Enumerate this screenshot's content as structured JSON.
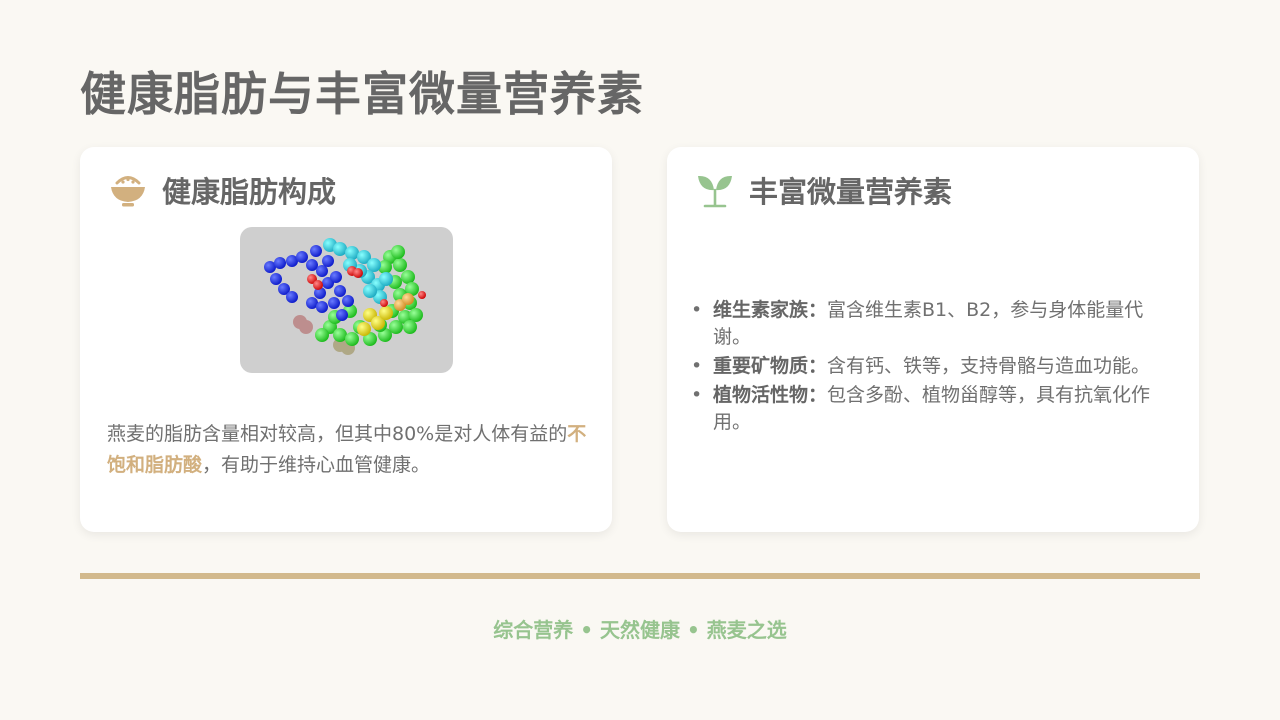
{
  "title": "健康脂肪与丰富微量营养素",
  "left_card": {
    "heading": "健康脂肪构成",
    "icon": "rice-bowl-icon",
    "image": "fat-molecule-3d-model",
    "text_before": "燕麦的脂肪含量相对较高，但其中80%是对人体有益的",
    "text_highlight": "不饱和脂肪酸",
    "text_after": "，有助于维持心血管健康。"
  },
  "right_card": {
    "heading": "丰富微量营养素",
    "icon": "seedling-icon",
    "bullets": [
      {
        "label": "维生素家族：",
        "text": "富含维生素B1、B2，参与身体能量代谢。"
      },
      {
        "label": "重要矿物质：",
        "text": "含有钙、铁等，支持骨骼与造血功能。"
      },
      {
        "label": "植物活性物：",
        "text": "包含多酚、植物甾醇等，具有抗氧化作用。"
      }
    ]
  },
  "footer": "综合营养 • 天然健康 • 燕麦之选",
  "colors": {
    "background": "#faf8f3",
    "accent_tan": "#d2b07f",
    "accent_green": "#97c48f",
    "text_gray": "#666666"
  }
}
